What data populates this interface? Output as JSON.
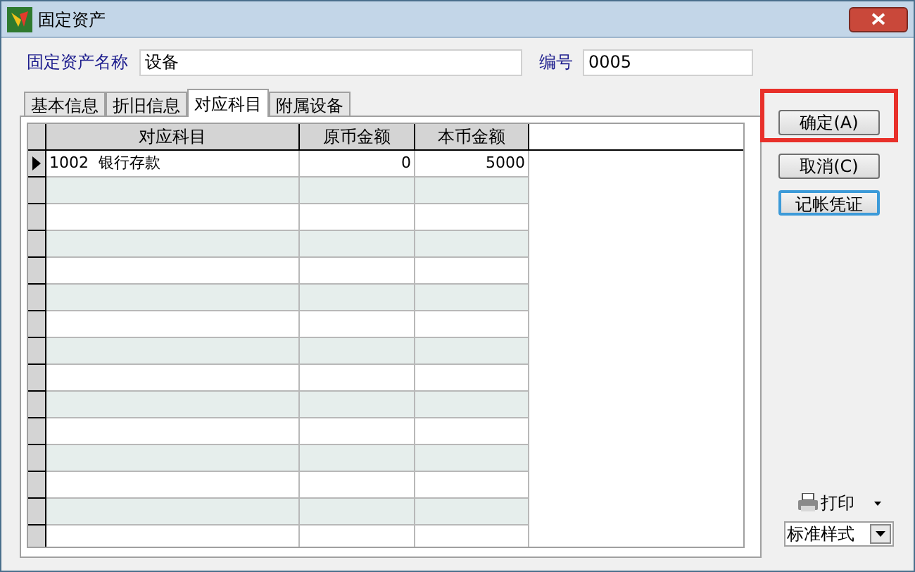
{
  "window": {
    "title": "固定资产"
  },
  "name_field": {
    "label": "固定资产名称",
    "value": "设备"
  },
  "number_field": {
    "label": "编号",
    "value": "0005"
  },
  "tabs": [
    {
      "label": "基本信息",
      "selected": false
    },
    {
      "label": "折旧信息",
      "selected": false
    },
    {
      "label": "对应科目",
      "selected": true
    },
    {
      "label": "附属设备",
      "selected": false
    }
  ],
  "table": {
    "columns": [
      "对应科目",
      "原币金额",
      "本币金额"
    ],
    "rows": [
      {
        "cells": [
          "1002  银行存款",
          "0",
          "5000"
        ],
        "current": true
      }
    ]
  },
  "buttons": [
    {
      "label": "确定(A)",
      "highlighted": true,
      "focused": false
    },
    {
      "label": "取消(C)",
      "highlighted": false,
      "focused": false
    },
    {
      "label": "记帐凭证",
      "highlighted": false,
      "focused": true
    }
  ],
  "print": {
    "label": "打印"
  },
  "style_select": {
    "value": "标准样式"
  }
}
